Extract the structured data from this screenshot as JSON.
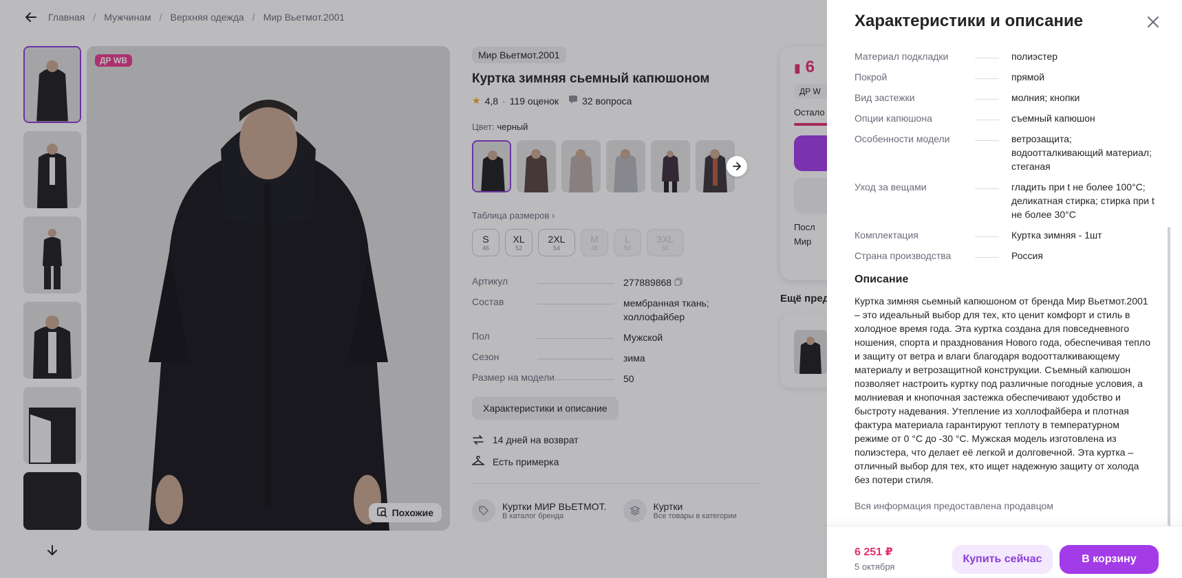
{
  "breadcrumb": {
    "items": [
      "Главная",
      "Мужчинам",
      "Верхняя одежда",
      "Мир Вьетмот.2001"
    ]
  },
  "gallery": {
    "badge": "ДР WB",
    "similar_label": "Похожие"
  },
  "product": {
    "brand": "Мир Вьетмот.2001",
    "title": "Куртка зимняя сьемный капюшоном",
    "rating": "4,8",
    "reviews": "119 оценок",
    "questions": "32 вопроса",
    "color_label": "Цвет:",
    "color_value": "черный",
    "size_table_link": "Таблица размеров",
    "sizes": [
      {
        "size": "S",
        "ru": "46",
        "available": true
      },
      {
        "size": "XL",
        "ru": "52",
        "available": true
      },
      {
        "size": "2XL",
        "ru": "54",
        "available": true
      },
      {
        "size": "M",
        "ru": "48",
        "available": false
      },
      {
        "size": "L",
        "ru": "50",
        "available": false
      },
      {
        "size": "3XL",
        "ru": "56",
        "available": false
      }
    ],
    "specs": [
      {
        "k": "Артикул",
        "v": "277889868"
      },
      {
        "k": "Состав",
        "v": "мембранная ткань; холлофайбер"
      },
      {
        "k": "Пол",
        "v": "Мужской"
      },
      {
        "k": "Сезон",
        "v": "зима"
      },
      {
        "k": "Размер на модели",
        "v": "50"
      }
    ],
    "char_button": "Характеристики и описание",
    "return_text": "14 дней на возврат",
    "fitting_text": "Есть примерка",
    "link_brand_title": "Куртки МИР ВЬЕТМОТ.",
    "link_brand_sub": "В каталог бренда",
    "link_cat_title": "Куртки",
    "link_cat_sub": "Все товары в категории"
  },
  "buybox": {
    "price_partial": "6",
    "tag_partial": "ДР W",
    "left_partial": "Остало",
    "line1": "Посл",
    "line2": "Мир"
  },
  "more": {
    "title_partial": "Ещё пред"
  },
  "panel": {
    "title": "Характеристики и описание",
    "rows": [
      {
        "k": "Материал подкладки",
        "v": "полиэстер"
      },
      {
        "k": "Покрой",
        "v": "прямой"
      },
      {
        "k": "Вид застежки",
        "v": "молния; кнопки"
      },
      {
        "k": "Опции капюшона",
        "v": "съемный капюшон"
      },
      {
        "k": "Особенности модели",
        "v": "ветрозащита; водоотталкивающий материал; стеганая"
      },
      {
        "k": "Уход за вещами",
        "v": "гладить при t не более 100°С; деликатная стирка; стирка при t не более 30°С"
      },
      {
        "k": "Комплектация",
        "v": "Куртка зимняя - 1шт"
      },
      {
        "k": "Страна производства",
        "v": "Россия"
      }
    ],
    "desc_title": "Описание",
    "description": "Куртка зимняя сьемный капюшоном от бренда Мир Вьетмот.2001 – это идеальный выбор для тех, кто ценит комфорт и стиль в холодное время года. Эта куртка создана для повседневного ношения, спорта и празднования Нового года, обеспечивая тепло и защиту от ветра и влаги благодаря водоотталкивающему материалу и ветрозащитной конструкции. Съемный капюшон позволяет настроить куртку под различные погодные условия, а молниевая и кнопочная застежка обеспечивают удобство и быстроту надевания. Утепление из холлофайбера и плотная фактура материала гарантируют теплоту в температурном режиме от 0 °С до -30 °С. Мужская модель изготовлена из полиэстера, что делает её легкой и долговечной. Эта куртка – отличный выбор для тех, кто ищет надежную защиту от холода без потери стиля.",
    "note": "Вся информация предоставлена продавцом",
    "price": "6 251 ₽",
    "delivery": "5 октября",
    "buy_now": "Купить сейчас",
    "to_cart": "В корзину"
  },
  "colors": {
    "accent": "#a43be8",
    "price": "#e32f6f",
    "badge": "#e83a8e"
  }
}
